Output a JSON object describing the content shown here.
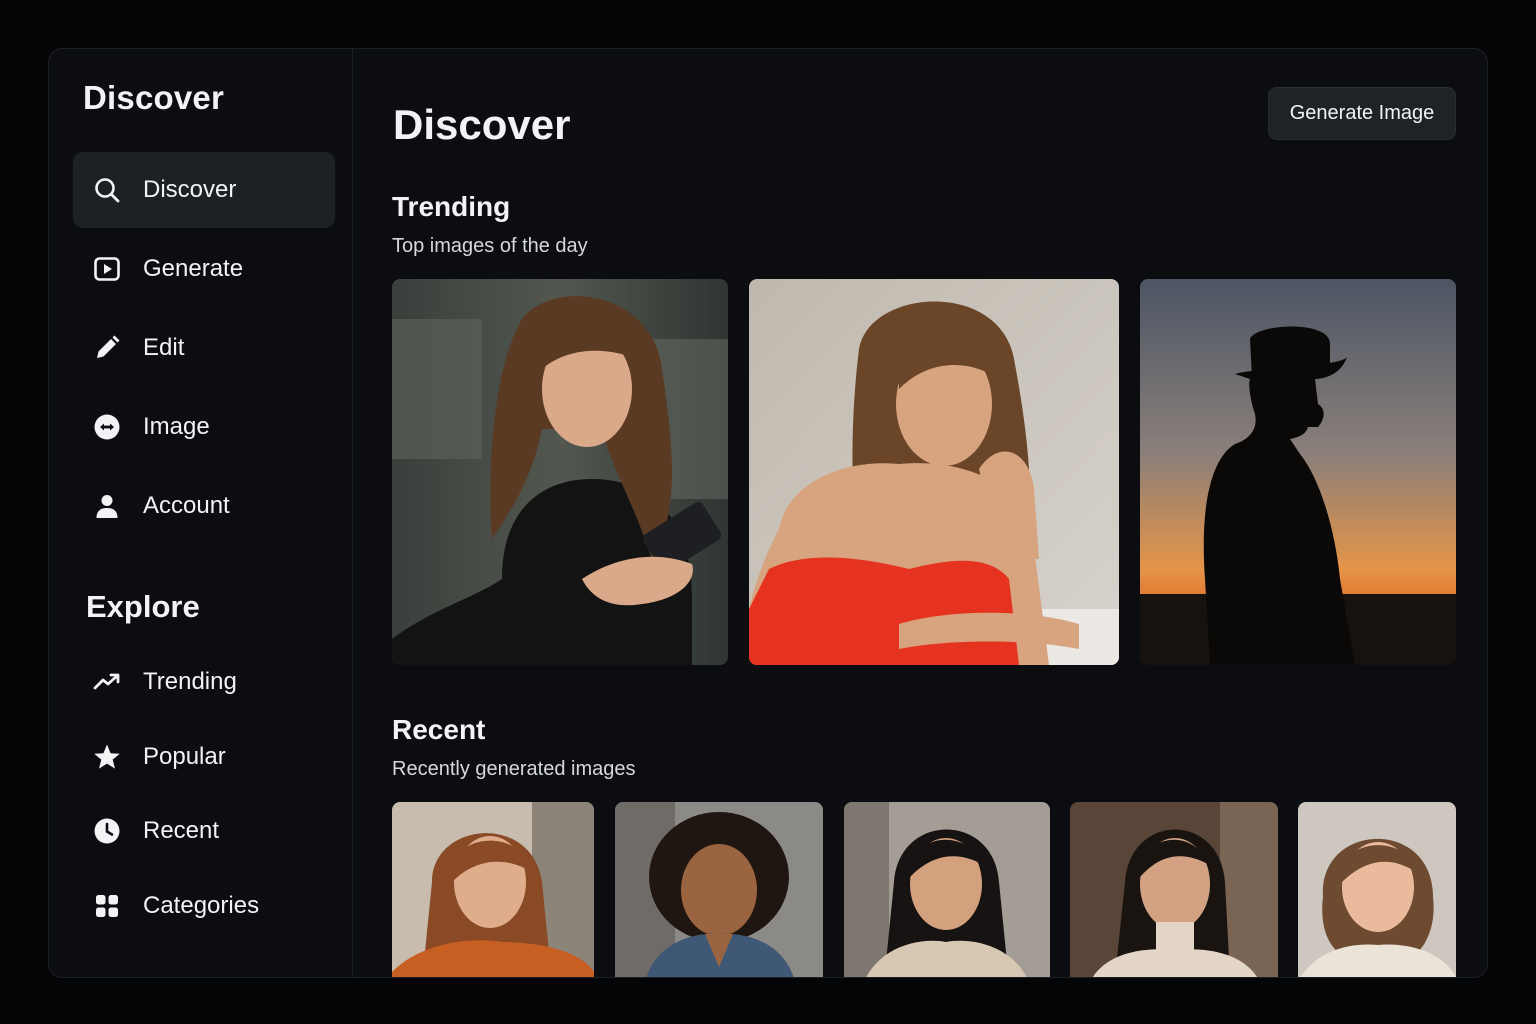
{
  "sidebar": {
    "app_title": "Discover",
    "nav": [
      {
        "label": "Discover",
        "icon": "search-icon",
        "active": true
      },
      {
        "label": "Generate",
        "icon": "play-square-icon",
        "active": false
      },
      {
        "label": "Edit",
        "icon": "pencil-icon",
        "active": false
      },
      {
        "label": "Image",
        "icon": "image-circle-icon",
        "active": false
      },
      {
        "label": "Account",
        "icon": "user-icon",
        "active": false
      }
    ],
    "explore_title": "Explore",
    "explore": [
      {
        "label": "Trending",
        "icon": "trending-up-icon"
      },
      {
        "label": "Popular",
        "icon": "star-icon"
      },
      {
        "label": "Recent",
        "icon": "clock-icon"
      },
      {
        "label": "Categories",
        "icon": "grid-icon"
      }
    ]
  },
  "main": {
    "title": "Discover",
    "generate_button": "Generate Image",
    "trending": {
      "title": "Trending",
      "subtitle": "Top images of the day",
      "images": [
        {
          "subject": "woman-with-phone"
        },
        {
          "subject": "woman-red-top-portrait"
        },
        {
          "subject": "man-silhouette-sunset"
        }
      ]
    },
    "recent": {
      "title": "Recent",
      "subtitle": "Recently generated images",
      "images": [
        {
          "subject": "smiling-woman-orange-sweater"
        },
        {
          "subject": "laughing-woman-curly-hair"
        },
        {
          "subject": "woman-dark-hair-beige-shirt"
        },
        {
          "subject": "woman-turtleneck"
        },
        {
          "subject": "smiling-woman-bob-hair"
        }
      ]
    }
  },
  "colors": {
    "background": "#040506",
    "panel": "#0b0d10",
    "active_item": "#1d2024",
    "button": "#1f2226",
    "text": "#f2f3f5"
  }
}
